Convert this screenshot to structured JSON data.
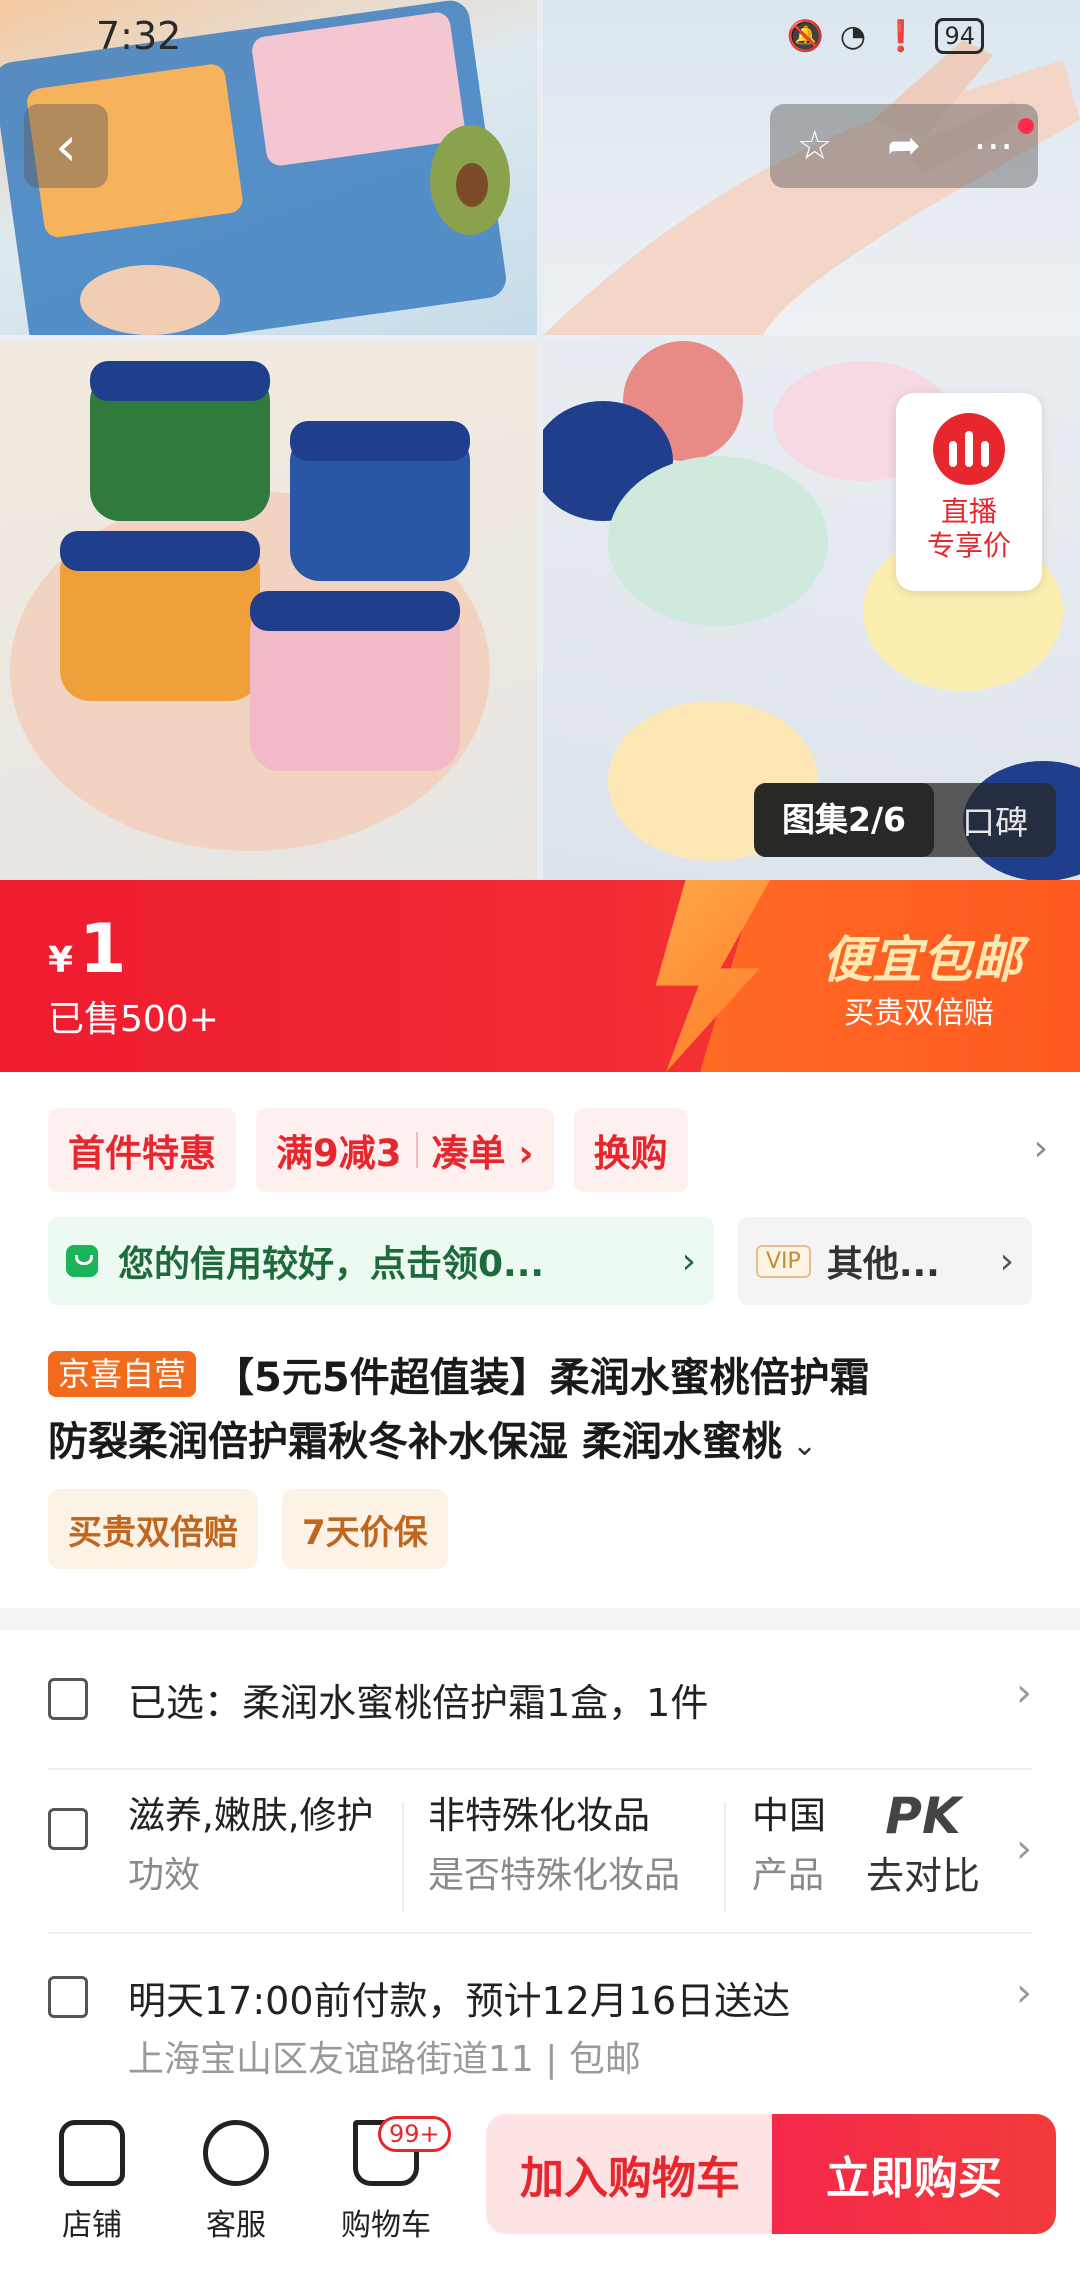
{
  "status_bar": {
    "time": "7:32",
    "battery": "94"
  },
  "gallery": {
    "tab_active": "图集2/6",
    "tab_other": "口碑"
  },
  "live_badge": {
    "line1": "直播",
    "line2": "专享价"
  },
  "price_banner": {
    "currency": "¥",
    "price": "1",
    "sold": "已售500+",
    "promo_title": "便宜包邮",
    "promo_sub": "买贵双倍赔"
  },
  "coupons": [
    {
      "label": "首件特惠"
    },
    {
      "label_a": "满9减3",
      "label_b": "凑单 ›"
    },
    {
      "label": "换购"
    }
  ],
  "credit": {
    "text": "您的信用较好，点击领0...",
    "arrow": "›"
  },
  "vip": {
    "tag": "VIP",
    "text": "其他...",
    "arrow": "›"
  },
  "title": {
    "tag": "京喜自营",
    "line1": "【5元5件超值装】柔润水蜜桃倍护霜",
    "line2": "防裂柔润倍护霜秋冬补水保湿 柔润水蜜桃"
  },
  "service_tags": [
    "买贵双倍赔",
    "7天价保"
  ],
  "selected": {
    "text": "已选：柔润水蜜桃倍护霜1盒，1件"
  },
  "attributes": [
    {
      "value": "滋养,嫩肤,修护",
      "key": "功效"
    },
    {
      "value": "非特殊化妆品",
      "key": "是否特殊化妆品"
    },
    {
      "value": "中国",
      "key": "产品"
    }
  ],
  "compare": {
    "big": "PK",
    "small": "去对比"
  },
  "delivery": {
    "line1": "明天17:00前付款，预计12月16日送达",
    "line2": "上海宝山区友谊路街道11 | 包邮"
  },
  "bottom_bar": {
    "shop": "店铺",
    "service": "客服",
    "cart": "购物车",
    "cart_badge": "99+",
    "add_to_cart": "加入购物车",
    "buy_now": "立即购买"
  },
  "colors": {
    "brand_red": "#e8262d",
    "promo_orange": "#ff6a25",
    "credit_green": "#19b45a"
  }
}
